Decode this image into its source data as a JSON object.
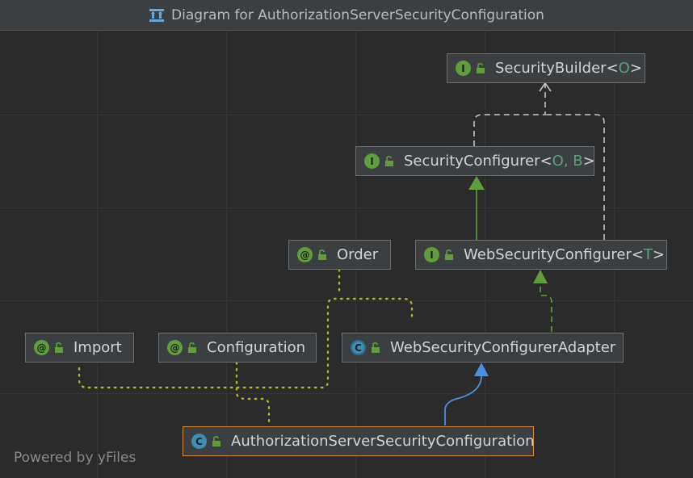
{
  "window": {
    "title": "Diagram for AuthorizationServerSecurityConfiguration",
    "icon": "diagram-icon"
  },
  "nodes": {
    "security_builder": {
      "name": "SecurityBuilder",
      "type_params": "O",
      "kind": "interface",
      "badge": "I"
    },
    "security_configurer": {
      "name": "SecurityConfigurer",
      "type_params": "O, B",
      "kind": "interface",
      "badge": "I"
    },
    "order": {
      "name": "Order",
      "kind": "annotation",
      "badge": "@"
    },
    "web_security_configurer": {
      "name": "WebSecurityConfigurer",
      "type_params": "T",
      "kind": "interface",
      "badge": "I"
    },
    "import": {
      "name": "Import",
      "kind": "annotation",
      "badge": "@"
    },
    "configuration": {
      "name": "Configuration",
      "kind": "annotation",
      "badge": "@"
    },
    "web_security_configurer_adapter": {
      "name": "WebSecurityConfigurerAdapter",
      "kind": "abstract-class",
      "badge": "C"
    },
    "authorization_server_security_configuration": {
      "name": "AuthorizationServerSecurityConfiguration",
      "kind": "class",
      "badge": "C",
      "selected": true
    }
  },
  "relations": [
    {
      "from": "security_configurer",
      "to": "security_builder",
      "type": "dependency-dashed"
    },
    {
      "from": "web_security_configurer",
      "to": "security_builder",
      "type": "dependency-dashed"
    },
    {
      "from": "web_security_configurer",
      "to": "security_configurer",
      "type": "extends"
    },
    {
      "from": "web_security_configurer_adapter",
      "to": "web_security_configurer",
      "type": "implements"
    },
    {
      "from": "authorization_server_security_configuration",
      "to": "web_security_configurer_adapter",
      "type": "extends"
    },
    {
      "from": "authorization_server_security_configuration",
      "to": "import",
      "type": "annotated-with"
    },
    {
      "from": "authorization_server_security_configuration",
      "to": "configuration",
      "type": "annotated-with"
    },
    {
      "from": "web_security_configurer_adapter",
      "to": "order",
      "type": "annotated-with"
    }
  ],
  "footer": {
    "watermark": "Powered by yFiles"
  },
  "colors": {
    "background": "#2b2b2b",
    "node_fill": "#3c3f41",
    "interface_badge": "#5f9e3a",
    "class_badge": "#3f8fb5",
    "selected_border": "#d88a3a",
    "extends_arrow": "#5f9e3a",
    "class_extends_arrow": "#4a90e2",
    "annotation_dots": "#b5b520",
    "dependency_dash": "#c8c8c8"
  }
}
